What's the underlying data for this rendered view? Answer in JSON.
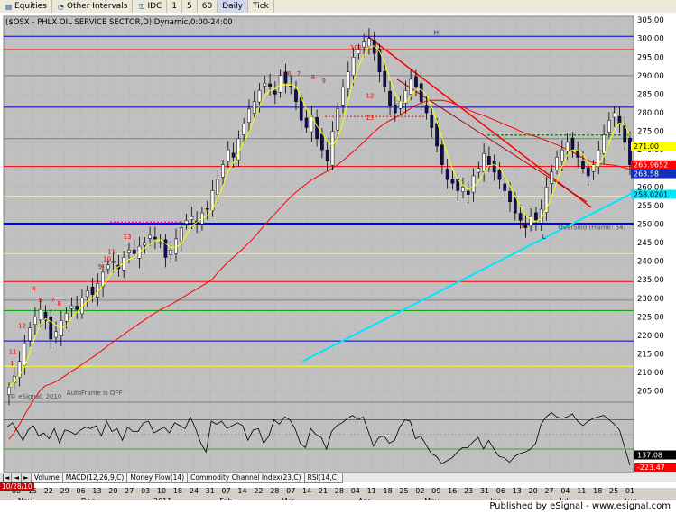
{
  "toolbar": {
    "items": [
      {
        "icon": "chart-icon",
        "label": "Equities"
      },
      {
        "icon": "interval-icon",
        "label": "Other Intervals"
      },
      {
        "icon": "lock-icon",
        "label": "IDC"
      },
      {
        "icon": "",
        "label": "1"
      },
      {
        "icon": "",
        "label": "5"
      },
      {
        "icon": "",
        "label": "60"
      },
      {
        "icon": "",
        "label": "Daily"
      },
      {
        "icon": "",
        "label": "Tick"
      }
    ]
  },
  "chart_data": {
    "type": "candlestick",
    "title": "($OSX - PHLX OIL SERVICE SECTOR,D) Dynamic,0:00-24:00",
    "ylim": [
      202,
      306
    ],
    "yticks": [
      205,
      210,
      215,
      220,
      225,
      230,
      235,
      240,
      245,
      250,
      255,
      260,
      265,
      270,
      275,
      280,
      285,
      290,
      295,
      300,
      305
    ],
    "x_months": [
      {
        "label": "Nov",
        "pos": 0.04
      },
      {
        "label": "Dec",
        "pos": 0.14
      },
      {
        "label": "2011",
        "pos": 0.255
      },
      {
        "label": "Feb",
        "pos": 0.36
      },
      {
        "label": "Mar",
        "pos": 0.458
      },
      {
        "label": "Apr",
        "pos": 0.58
      },
      {
        "label": "May",
        "pos": 0.685
      },
      {
        "label": "Jun",
        "pos": 0.79
      },
      {
        "label": "Jul",
        "pos": 0.9
      },
      {
        "label": "Aug",
        "pos": 1.0
      }
    ],
    "x_days": [
      "08",
      "15",
      "22",
      "29",
      "06",
      "13",
      "20",
      "27",
      "03",
      "10",
      "18",
      "24",
      "31",
      "07",
      "14",
      "22",
      "28",
      "07",
      "14",
      "21",
      "28",
      "04",
      "11",
      "18",
      "25",
      "02",
      "09",
      "16",
      "23",
      "31",
      "06",
      "13",
      "20",
      "27",
      "04",
      "11",
      "18",
      "25",
      "01"
    ],
    "close": [
      206,
      209,
      213,
      218,
      222,
      225,
      227,
      224,
      219,
      221,
      224,
      226,
      228,
      227,
      230,
      232,
      231,
      234,
      237,
      239,
      240,
      238,
      241,
      243,
      242,
      244,
      245,
      247,
      246,
      245,
      241,
      243,
      246,
      249,
      251,
      252,
      250,
      253,
      254,
      259,
      262,
      266,
      270,
      268,
      273,
      277,
      281,
      283,
      286,
      288,
      287,
      285,
      290,
      288,
      287,
      283,
      278,
      276,
      279,
      273,
      270,
      267,
      275,
      281,
      287,
      291,
      295,
      297,
      299,
      300,
      296,
      291,
      287,
      282,
      280,
      283,
      286,
      289,
      287,
      283,
      280,
      276,
      271,
      266,
      262,
      261,
      259,
      260,
      258,
      263,
      265,
      269,
      266,
      264,
      262,
      259,
      256,
      253,
      251,
      249,
      252,
      251,
      254,
      260,
      264,
      268,
      270,
      272,
      270,
      268,
      265,
      263,
      266,
      270,
      274,
      278,
      280,
      277,
      272,
      266
    ],
    "labels": {
      "price_boxes": [
        {
          "text": "271.00",
          "value": 271.0
        },
        {
          "text": "265.9652",
          "value": 265.97
        },
        {
          "text": "263.58",
          "value": 263.58
        },
        {
          "text": "258.0201",
          "value": 258.02
        }
      ],
      "indicator_boxes": [
        {
          "text": "137.08"
        },
        {
          "text": "-223.47"
        }
      ],
      "annotations": [
        {
          "text": "101",
          "x": 0.55,
          "y": 297
        },
        {
          "text": "H",
          "x": 0.683,
          "y": 301
        },
        {
          "text": "L",
          "x": 0.855,
          "y": 246
        },
        {
          "text": "OverSold (Frame: 64)",
          "x": 0.88,
          "y": 248.5
        },
        {
          "text": "AutoFrame is OFF",
          "x": 0.1,
          "y": 204
        },
        {
          "text": "© eSignal, 2010",
          "x": 0.01,
          "y": 203
        }
      ],
      "seq_counts": [
        {
          "text": "1",
          "x": 0.01,
          "y": 212
        },
        {
          "text": "11",
          "x": 0.008,
          "y": 215
        },
        {
          "text": "12",
          "x": 0.023,
          "y": 222
        },
        {
          "text": "4",
          "x": 0.045,
          "y": 232
        },
        {
          "text": "5",
          "x": 0.055,
          "y": 229
        },
        {
          "text": "7",
          "x": 0.075,
          "y": 229
        },
        {
          "text": "8",
          "x": 0.085,
          "y": 228
        },
        {
          "text": "9",
          "x": 0.15,
          "y": 238
        },
        {
          "text": "10",
          "x": 0.158,
          "y": 240
        },
        {
          "text": "11",
          "x": 0.165,
          "y": 242
        },
        {
          "text": "13",
          "x": 0.19,
          "y": 246
        },
        {
          "text": "6",
          "x": 0.45,
          "y": 290
        },
        {
          "text": "7",
          "x": 0.465,
          "y": 290
        },
        {
          "text": "8",
          "x": 0.488,
          "y": 289
        },
        {
          "text": "9",
          "x": 0.505,
          "y": 288
        },
        {
          "text": "13",
          "x": 0.575,
          "y": 278
        },
        {
          "text": "12",
          "x": 0.575,
          "y": 284
        },
        {
          "text": "9",
          "x": 0.82,
          "y": 249
        }
      ]
    },
    "horizontal_lines": [
      {
        "value": 300.6,
        "color": "#0000c8",
        "width": 1
      },
      {
        "value": 297,
        "color": "#ff0000",
        "width": 1
      },
      {
        "value": 290,
        "color": "#808080",
        "width": 1
      },
      {
        "value": 281.5,
        "color": "#0000c8",
        "width": 1
      },
      {
        "value": 273,
        "color": "#808080",
        "width": 1
      },
      {
        "value": 265.5,
        "color": "#ff0000",
        "width": 1
      },
      {
        "value": 257.5,
        "color": "#ffff00",
        "width": 1
      },
      {
        "value": 250,
        "color": "#0000ff",
        "width": 3
      },
      {
        "value": 242,
        "color": "#ffff00",
        "width": 1
      },
      {
        "value": 234.5,
        "color": "#ff0000",
        "width": 1
      },
      {
        "value": 229.5,
        "color": "#808080",
        "width": 1
      },
      {
        "value": 226.7,
        "color": "#00a000",
        "width": 1
      },
      {
        "value": 218.5,
        "color": "#0000c8",
        "width": 1
      },
      {
        "value": 211.7,
        "color": "#ffff00",
        "width": 1
      }
    ],
    "indicator": {
      "name": "Commodity Channel Index(23,C)",
      "ylim": [
        -260,
        220
      ],
      "upper": 100,
      "lower": -100,
      "values": [
        50,
        80,
        20,
        -40,
        30,
        60,
        -10,
        10,
        -30,
        40,
        -60,
        30,
        20,
        0,
        30,
        50,
        40,
        60,
        -10,
        90,
        20,
        40,
        -40,
        50,
        20,
        20,
        80,
        90,
        10,
        30,
        50,
        10,
        80,
        60,
        40,
        120,
        40,
        -60,
        -120,
        90,
        70,
        90,
        40,
        60,
        80,
        60,
        -40,
        30,
        40,
        -60,
        -10,
        100,
        70,
        120,
        100,
        40,
        -60,
        -90,
        40,
        0,
        -20,
        -100,
        20,
        60,
        80,
        110,
        130,
        100,
        120,
        20,
        -80,
        -20,
        -10,
        -60,
        -40,
        50,
        100,
        90,
        -30,
        -10,
        -70,
        -130,
        -150,
        -200,
        -180,
        -160,
        -120,
        -90,
        -90,
        -50,
        -20,
        -100,
        -40,
        -100,
        -150,
        -160,
        -190,
        -150,
        -130,
        -120,
        -100,
        -60,
        70,
        120,
        150,
        120,
        110,
        120,
        140,
        90,
        60,
        90,
        110,
        120,
        130,
        100,
        70,
        30,
        -90,
        -210
      ]
    }
  },
  "tabs": {
    "items": [
      "Volume",
      "MACD(12,26,9,C)",
      "Money Flow(14)",
      "Commodity Channel Index(23,C)",
      "RSI(14,C)"
    ],
    "nav_prev": "|◄",
    "nav_left": "◄",
    "nav_right": "►"
  },
  "date_box": "10/28/10",
  "footer": {
    "text": "Published by eSignal - www.esignal.com"
  },
  "colors": {
    "background": "#c0c0c0",
    "up_candle": "#ffffff",
    "down_candle": "#0f0f5a",
    "wick": "#000000",
    "sma_short": "#ffff00",
    "sma_long": "#ff0000",
    "trend_cyan": "#00e6ff",
    "trend_red": "#ff0000",
    "dotted_magenta": "#ff00ff",
    "dotted_green": "#00a000"
  }
}
